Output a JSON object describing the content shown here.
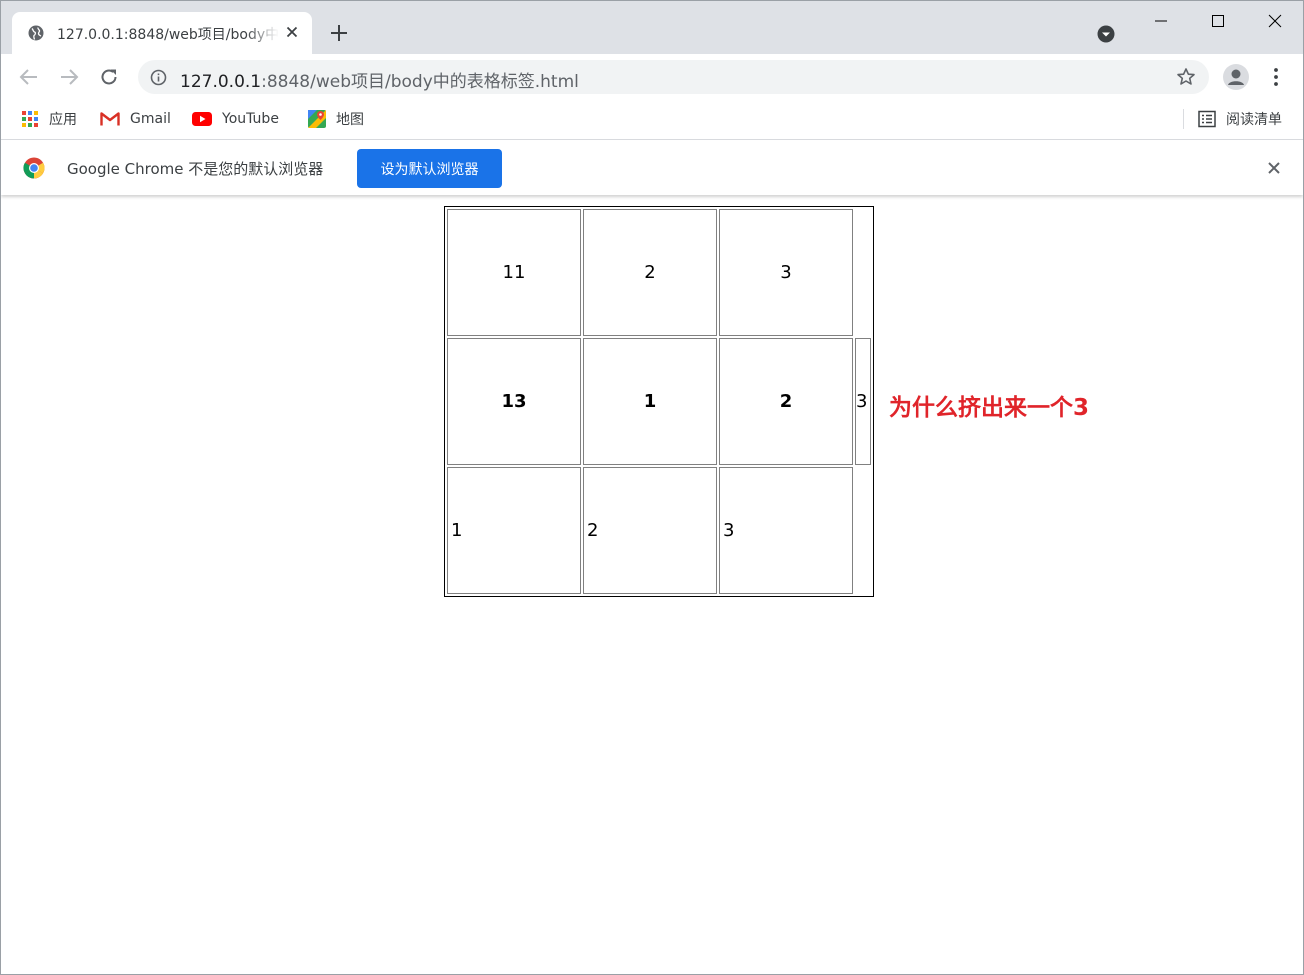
{
  "tab": {
    "title": "127.0.0.1:8848/web项目/body中的表格标签.html"
  },
  "toolbar": {
    "url_host": "127.0.0.1",
    "url_path": ":8848/web项目/body中的表格标签.html"
  },
  "bookmarks": {
    "apps": "应用",
    "gmail": "Gmail",
    "youtube": "YouTube",
    "maps": "地图",
    "reading_list": "阅读清单"
  },
  "infobar": {
    "message": "Google Chrome 不是您的默认浏览器",
    "button": "设为默认浏览器"
  },
  "table": {
    "row1": [
      "11",
      "2",
      "3"
    ],
    "row2": [
      "13",
      "1",
      "2",
      "3"
    ],
    "row3": [
      "1",
      "2",
      "3"
    ]
  },
  "note": "为什么挤出来一个3",
  "colors": {
    "accent": "#1a73e8",
    "note": "#e0242a",
    "tabstrip": "#dee1e6"
  }
}
